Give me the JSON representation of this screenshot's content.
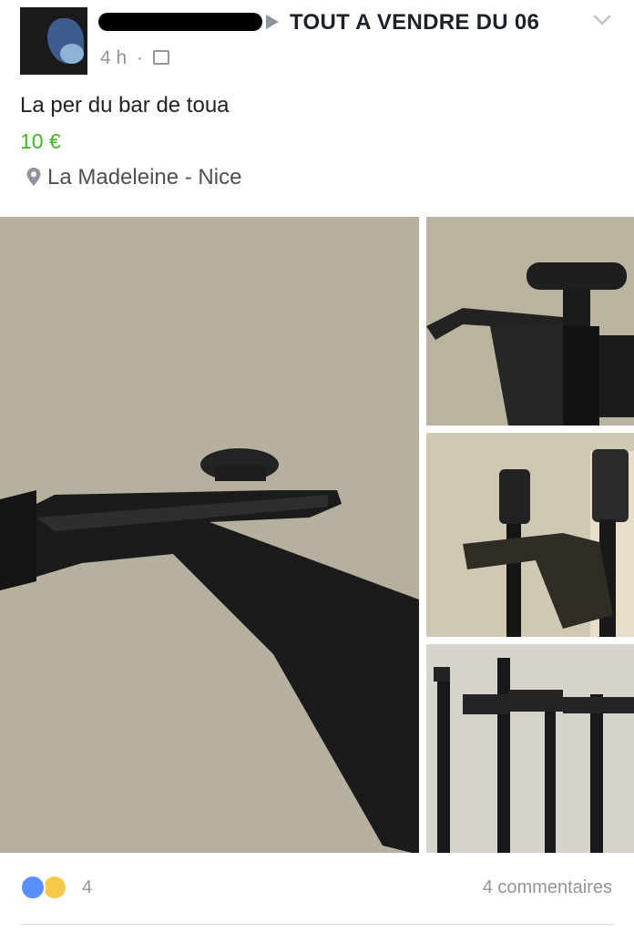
{
  "post": {
    "group_name": "TOUT A VENDRE DU 06",
    "time": "4 h",
    "separator": "·",
    "audience_icon": "group-icon",
    "title": "La per du bar de toua",
    "price": "10 €",
    "location": "La Madeleine - Nice",
    "location_icon": "map-pin-icon"
  },
  "footer": {
    "reaction_icons": [
      "like-icon",
      "haha-icon"
    ],
    "reaction_count": "4",
    "comments": "4 commentaires"
  },
  "colors": {
    "price": "#42b72a",
    "secondary_text": "#90949c",
    "like": "#5890ff",
    "haha": "#f7c94b"
  }
}
